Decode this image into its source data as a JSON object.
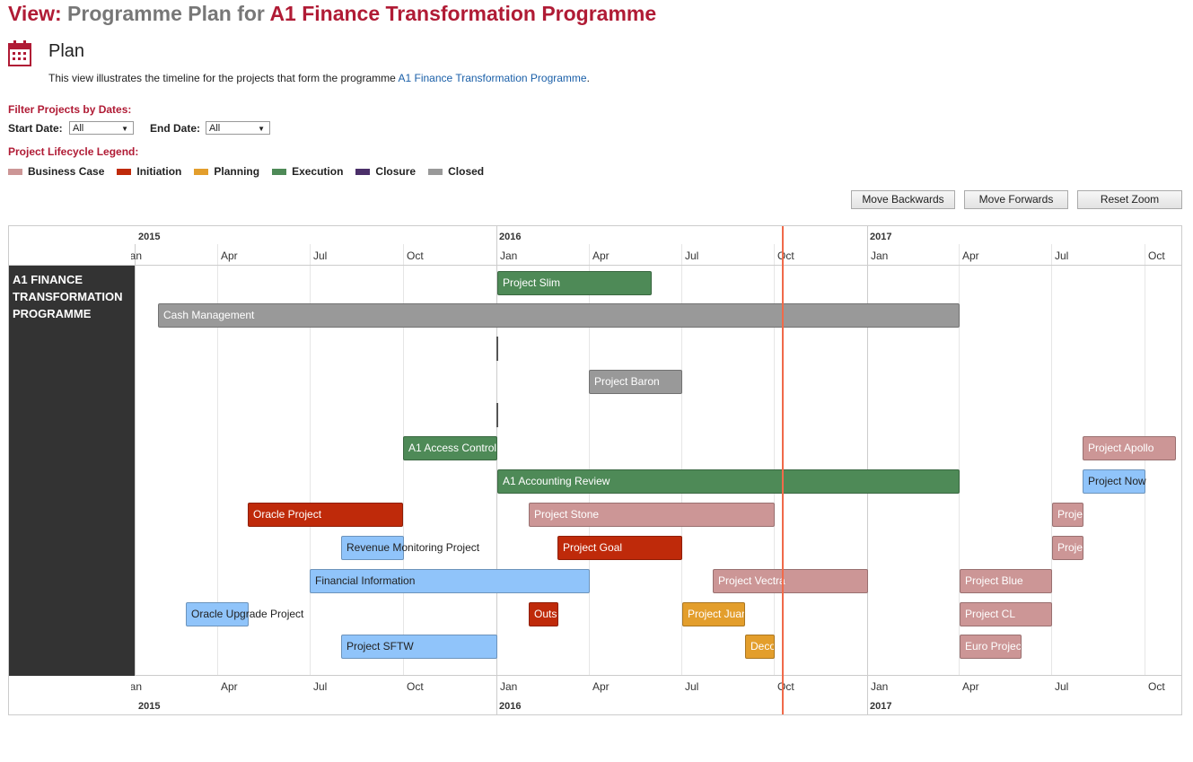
{
  "page": {
    "title_prefix": "View:",
    "title_mid": "Programme Plan for",
    "title_name": "A1 Finance Transformation Programme",
    "section_heading": "Plan",
    "description": "This view illustrates the timeline for the projects that form the programme ",
    "description_link": "A1 Finance Transformation Programme",
    "description_end": "."
  },
  "filter": {
    "heading": "Filter Projects by Dates:",
    "start_label": "Start Date:",
    "start_value": "All",
    "end_label": "End Date:",
    "end_value": "All"
  },
  "legend": {
    "heading": "Project Lifecycle Legend:",
    "items": [
      {
        "label": "Business Case",
        "color": "#cc9696"
      },
      {
        "label": "Initiation",
        "color": "#bf2a0a"
      },
      {
        "label": "Planning",
        "color": "#e39e2c"
      },
      {
        "label": "Execution",
        "color": "#4e8a57"
      },
      {
        "label": "Closure",
        "color": "#4b2f69"
      },
      {
        "label": "Closed",
        "color": "#999999"
      }
    ]
  },
  "toolbar": {
    "back_label": "Move Backwards",
    "forward_label": "Move Forwards",
    "reset_label": "Reset Zoom"
  },
  "timeline": {
    "group_label": "A1 FINANCE TRANSFORMATION PROGRAMME",
    "years": [
      "2015",
      "2016",
      "2017"
    ],
    "months": [
      "Jan",
      "Apr",
      "Jul",
      "Oct",
      "Jan",
      "Apr",
      "Jul",
      "Oct",
      "Jan",
      "Apr",
      "Jul",
      "Oct"
    ],
    "today": "Oct 2016",
    "projects": [
      {
        "name": "Project Slim",
        "phase": "Execution"
      },
      {
        "name": "Cash Management",
        "phase": "Closed"
      },
      {
        "name": "Project Baron",
        "phase": "Closed"
      },
      {
        "name": "A1 Access Control",
        "phase": "Execution"
      },
      {
        "name": "Project Apollo",
        "phase": "Business Case"
      },
      {
        "name": "A1 Accounting Review",
        "phase": "Execution"
      },
      {
        "name": "Project Now",
        "phase": ""
      },
      {
        "name": "Oracle Project",
        "phase": "Initiation"
      },
      {
        "name": "Project Stone",
        "phase": "Business Case"
      },
      {
        "name": "Project",
        "phase": "Business Case"
      },
      {
        "name": "Revenue Monitoring Project",
        "phase": ""
      },
      {
        "name": "Project Goal",
        "phase": "Initiation"
      },
      {
        "name": "Project",
        "phase": "Business Case"
      },
      {
        "name": "Financial Information",
        "phase": ""
      },
      {
        "name": "Project Vectra",
        "phase": "Business Case"
      },
      {
        "name": "Project Blue",
        "phase": "Business Case"
      },
      {
        "name": "Oracle Upgrade Project",
        "phase": ""
      },
      {
        "name": "Outsourcing",
        "phase": "Initiation"
      },
      {
        "name": "Project Juan",
        "phase": "Planning"
      },
      {
        "name": "Project CL",
        "phase": "Business Case"
      },
      {
        "name": "Project SFTW",
        "phase": ""
      },
      {
        "name": "Decom",
        "phase": "Planning"
      },
      {
        "name": "Euro Project",
        "phase": "Business Case"
      }
    ]
  }
}
